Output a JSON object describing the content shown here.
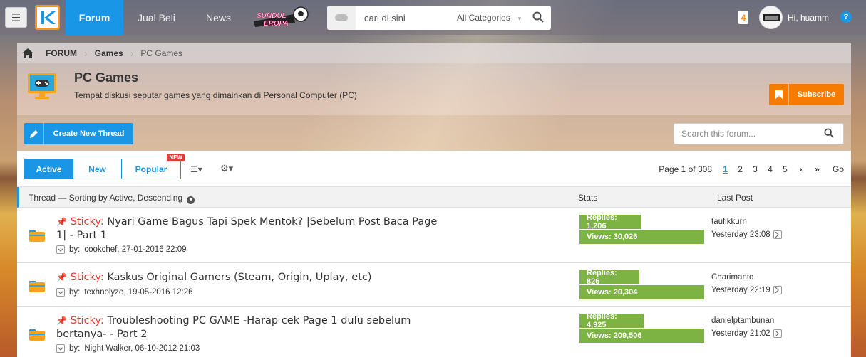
{
  "topbar": {
    "nav": [
      {
        "label": "Forum",
        "active": true
      },
      {
        "label": "Jual Beli"
      },
      {
        "label": "News"
      }
    ],
    "promo_text": "SUNDUL EROPA",
    "search": {
      "placeholder": "cari di sini",
      "category": "All Categories"
    },
    "notif_count": "4",
    "greeting": "Hi, huamm",
    "help": "?"
  },
  "breadcrumb": {
    "items": [
      "FORUM",
      "Games",
      "PC Games"
    ]
  },
  "forum": {
    "title": "PC Games",
    "description": "Tempat diskusi seputar games yang dimainkan di Personal Computer (PC)",
    "subscribe_label": "Subscribe",
    "create_label": "Create New Thread",
    "search_placeholder": "Search this forum..."
  },
  "tabs": [
    {
      "label": "Active",
      "active": true
    },
    {
      "label": "New"
    },
    {
      "label": "Popular",
      "badge": "NEW"
    }
  ],
  "pager": {
    "info": "Page 1 of 308",
    "pages": [
      "1",
      "2",
      "3",
      "4",
      "5"
    ],
    "current": "1",
    "go": "Go"
  },
  "table": {
    "thread_header": "Thread — Sorting by Active, Descending",
    "stats_header": "Stats",
    "lastpost_header": "Last Post"
  },
  "threads": [
    {
      "sticky": "Sticky:",
      "title": "Nyari Game Bagus Tapi Spek Mentok? |Sebelum Post Baca Page 1| - Part 1",
      "by": "by:",
      "author_date": "cookchef, 27-01-2016 22:09",
      "replies": "Replies: 1,206",
      "views": "Views: 30,026",
      "last_user": "taufikkurn",
      "last_time": "Yesterday 23:08"
    },
    {
      "sticky": "Sticky:",
      "title": "Kaskus Original Gamers (Steam, Origin, Uplay, etc)",
      "by": "by:",
      "author_date": "texhnolyze, 19-05-2016 12:26",
      "replies": "Replies: 826",
      "views": "Views: 20,304",
      "last_user": "Charimanto",
      "last_time": "Yesterday 22:19"
    },
    {
      "sticky": "Sticky:",
      "title": "Troubleshooting PC GAME -Harap cek Page 1 dulu sebelum bertanya- - Part 2",
      "by": "by:",
      "author_date": "Night Walker, 06-10-2012 21:03",
      "replies": "Replies: 4,925",
      "views": "Views: 209,506",
      "last_user": "danielptambunan",
      "last_time": "Yesterday 21:02"
    }
  ]
}
